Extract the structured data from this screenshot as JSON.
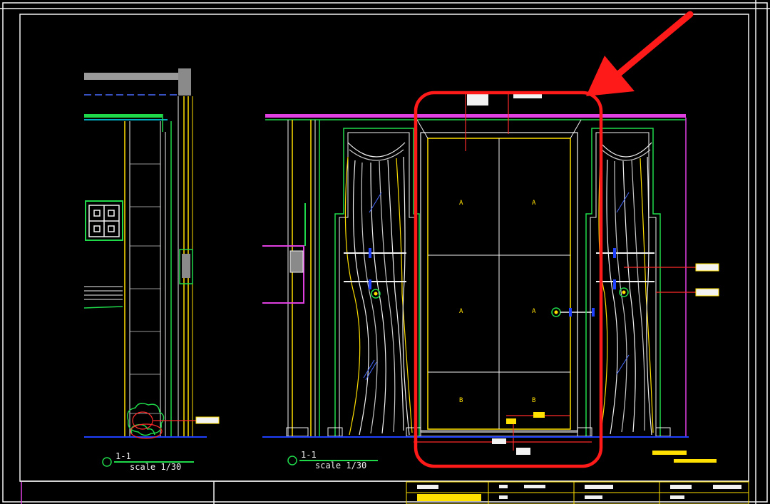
{
  "drawing": {
    "left_section": {
      "title": "1-1",
      "scale": "scale 1/30"
    },
    "right_elevation": {
      "title": "1-1",
      "scale": "scale 1/30"
    },
    "panel_marks": [
      "A",
      "A",
      "A",
      "A",
      "B",
      "B"
    ]
  },
  "colors": {
    "background": "#000000",
    "frame": "#f2f2f2",
    "cyan": "#00e5ff",
    "green": "#1fd94a",
    "yellow": "#ffe000",
    "magenta": "#e040e0",
    "red_line": "#ff2a2a",
    "highlight": "#ff1a1a",
    "blue_floor": "#2040ff"
  },
  "annotation": {
    "highlight_box": "red-rounded-rectangle",
    "arrow": "red-arrow"
  }
}
